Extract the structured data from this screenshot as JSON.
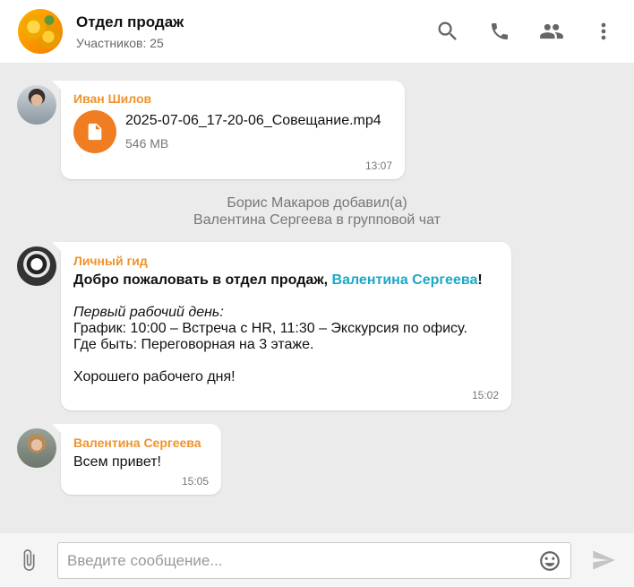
{
  "header": {
    "title": "Отдел продаж",
    "subtitle": "Участников: 25",
    "icons": [
      "search-icon",
      "phone-icon",
      "group-icon",
      "more-vert-icon"
    ]
  },
  "messages": [
    {
      "sender": "Иван Шилов",
      "file": {
        "name": "2025-07-06_17-20-06_Совещание.mp4",
        "size": "546 MB"
      },
      "time": "13:07"
    },
    {
      "sender": "Личный гид",
      "greeting_prefix": "Добро пожаловать в отдел продаж, ",
      "mention": "Валентина Сергеева",
      "greeting_suffix": "!",
      "schedule_title": "Первый рабочий день:",
      "schedule_line": "График: 10:00 – Встреча с HR, 11:30 – Экскурсия по офису.",
      "location_line": "Где быть: Переговорная на 3 этаже.",
      "closing": "Хорошего рабочего дня!",
      "time": "15:02"
    },
    {
      "sender": "Валентина Сергеева",
      "text": "Всем привет!",
      "time": "15:05"
    }
  ],
  "system_message": {
    "line1": "Борис Макаров добавил(а)",
    "line2": "Валентина Сергеева в групповой чат"
  },
  "composer": {
    "placeholder": "Введите сообщение...",
    "value": ""
  },
  "colors": {
    "sender": "#f0932b",
    "mention": "#1ba8c7",
    "file_icon": "#f07d22",
    "background": "#ebebeb"
  }
}
